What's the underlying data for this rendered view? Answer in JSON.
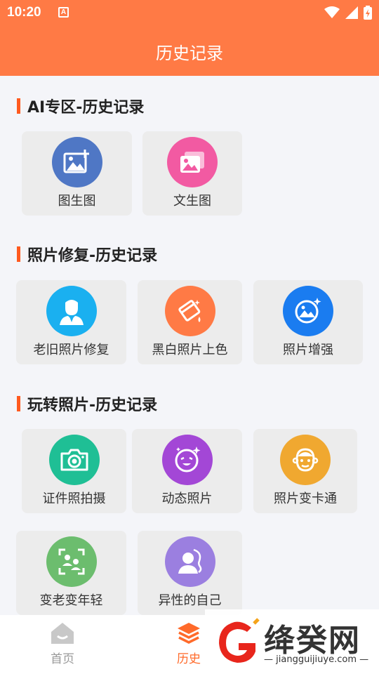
{
  "status": {
    "time": "10:20",
    "indicator": "A"
  },
  "header": {
    "title": "历史记录"
  },
  "sections": [
    {
      "title": "AI专区-历史记录",
      "items": [
        {
          "label": "图生图",
          "icon": "image-add-icon",
          "color": "#4f77c5"
        },
        {
          "label": "文生图",
          "icon": "gallery-icon",
          "color": "#f25aa2"
        }
      ]
    },
    {
      "title": "照片修复-历史记录",
      "items": [
        {
          "label": "老旧照片修复",
          "icon": "person-portrait-icon",
          "color": "#1ab0f0"
        },
        {
          "label": "黑白照片上色",
          "icon": "paint-bucket-icon",
          "color": "#ff7a45"
        },
        {
          "label": "照片增强",
          "icon": "image-sparkle-icon",
          "color": "#1a7cf0"
        }
      ]
    },
    {
      "title": "玩转照片-历史记录",
      "items": [
        {
          "label": "证件照拍摄",
          "icon": "camera-icon",
          "color": "#1fbf95"
        },
        {
          "label": "动态照片",
          "icon": "face-sparkle-icon",
          "color": "#a347d6"
        },
        {
          "label": "照片变卡通",
          "icon": "cartoon-face-icon",
          "color": "#f0a830"
        },
        {
          "label": "变老变年轻",
          "icon": "face-scan-icon",
          "color": "#6cbd6e"
        },
        {
          "label": "异性的自己",
          "icon": "gender-swap-icon",
          "color": "#9b7fe0"
        }
      ]
    }
  ],
  "nav": {
    "home": "首页",
    "history": "历史"
  },
  "watermark": {
    "text": "绛癸网",
    "domain": "jiangguijiuye.com"
  }
}
